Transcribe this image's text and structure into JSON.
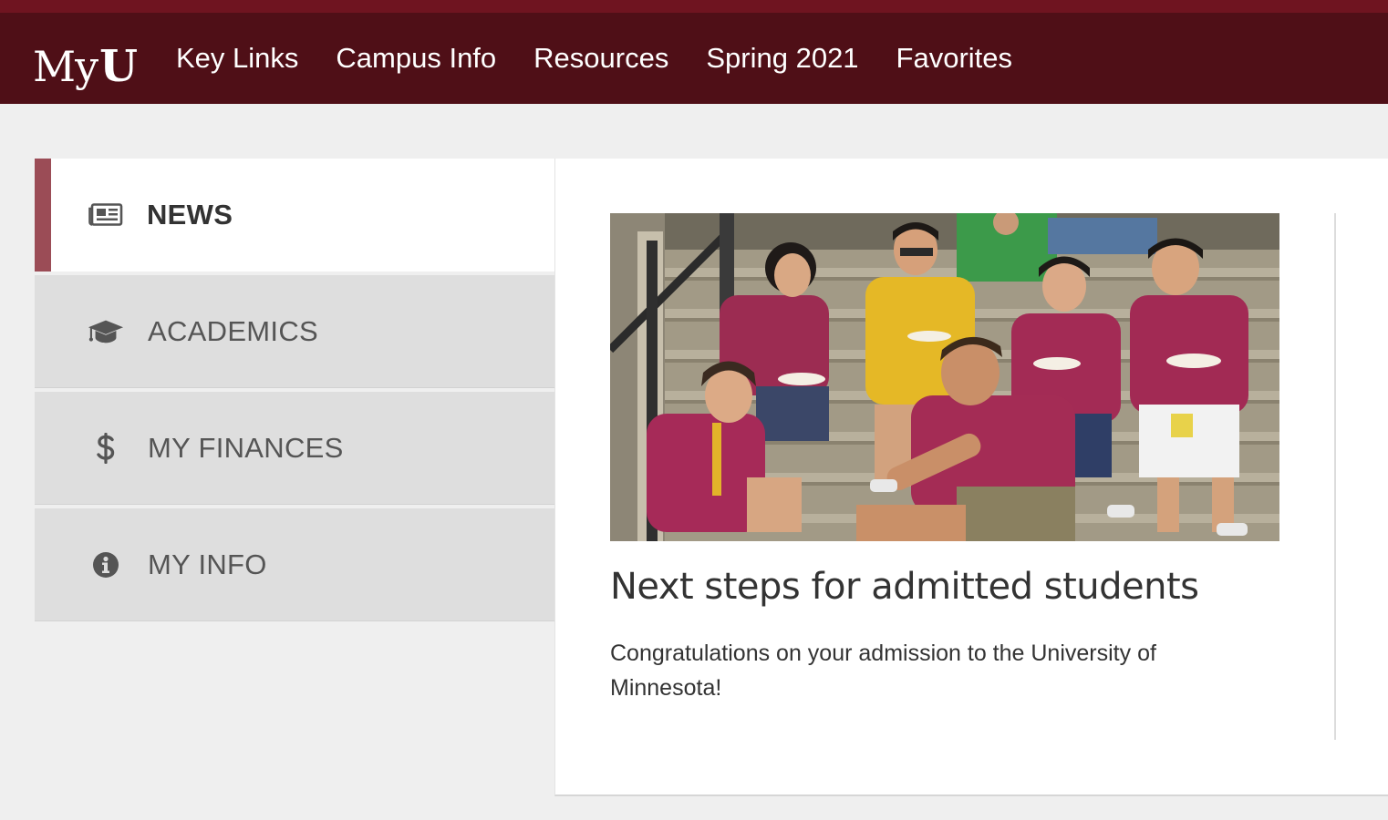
{
  "brand": {
    "my": "My",
    "u": "U",
    "primary_color": "#4f0f17",
    "strip_color": "#6f1420",
    "accent_color": "#9b4c56"
  },
  "nav": {
    "items": [
      {
        "label": "Key Links"
      },
      {
        "label": "Campus Info"
      },
      {
        "label": "Resources"
      },
      {
        "label": "Spring 2021"
      },
      {
        "label": "Favorites"
      }
    ]
  },
  "tabs": [
    {
      "label": "NEWS",
      "icon": "newspaper-icon",
      "active": true
    },
    {
      "label": "ACADEMICS",
      "icon": "graduation-cap-icon",
      "active": false
    },
    {
      "label": "MY FINANCES",
      "icon": "dollar-icon",
      "active": false
    },
    {
      "label": "MY INFO",
      "icon": "info-circle-icon",
      "active": false
    }
  ],
  "news": {
    "image": "students-on-steps-photo",
    "headline": "Next steps for admitted students",
    "summary": "Congratulations on your admission to the University of Minnesota!"
  }
}
